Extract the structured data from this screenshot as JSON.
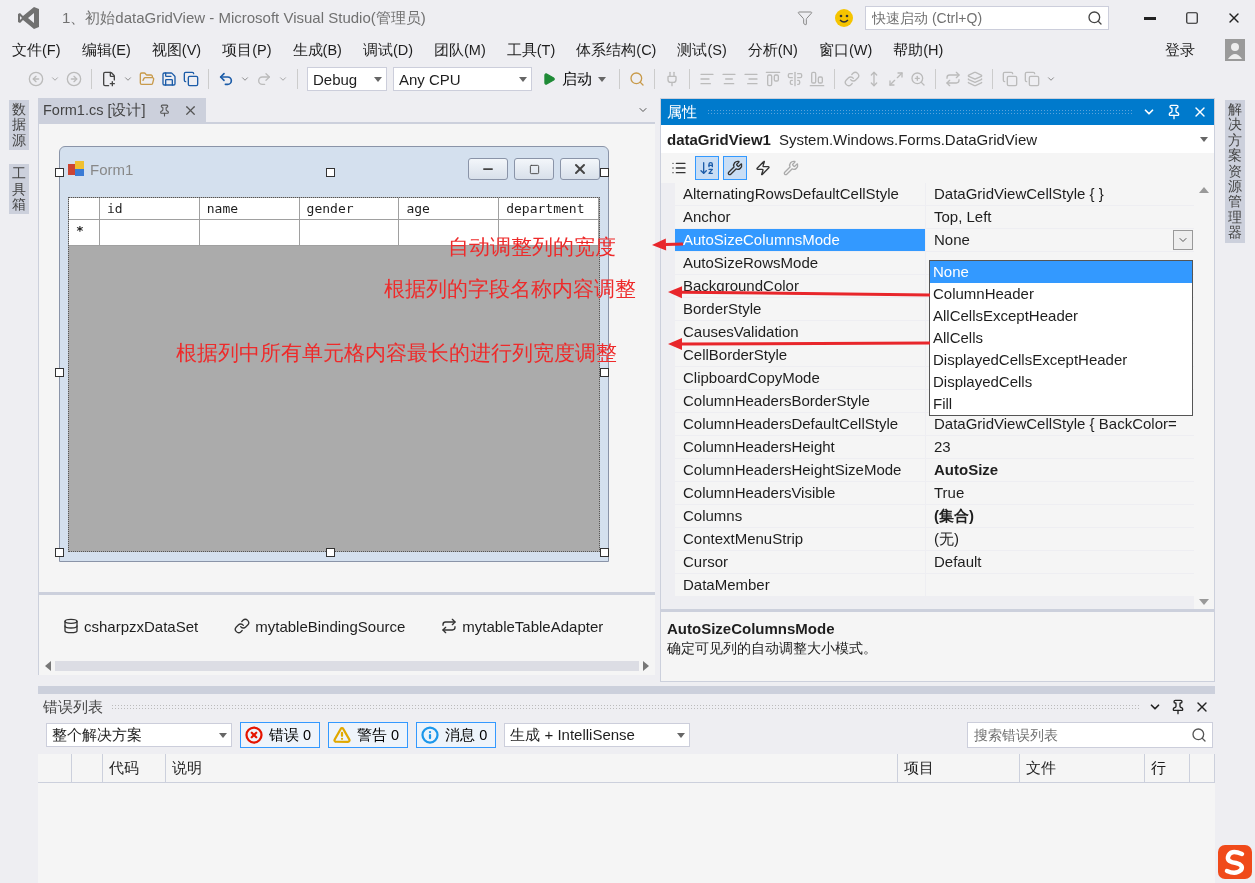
{
  "window": {
    "title": "1、初始dataGridView - Microsoft Visual Studio(管理员)",
    "quick_launch": {
      "placeholder": "快速启动 (Ctrl+Q)"
    },
    "sign_in": "登录"
  },
  "menu": [
    "文件(F)",
    "编辑(E)",
    "视图(V)",
    "项目(P)",
    "生成(B)",
    "调试(D)",
    "团队(M)",
    "工具(T)",
    "体系结构(C)",
    "测试(S)",
    "分析(N)",
    "窗口(W)",
    "帮助(H)"
  ],
  "toolbar": {
    "configuration": "Debug",
    "platform": "Any CPU",
    "start": "启动"
  },
  "left_tabs": [
    "数据源",
    "工具箱"
  ],
  "right_tabs": [
    "解决方案资源管理器"
  ],
  "designer": {
    "tab": "Form1.cs [设计]",
    "form_title": "Form1",
    "grid": {
      "columns": [
        "id",
        "name",
        "gender",
        "age",
        "department"
      ],
      "new_row_marker": "*"
    },
    "components": [
      "csharpzxDataSet",
      "mytableBindingSource",
      "mytableTableAdapter"
    ]
  },
  "properties": {
    "title": "属性",
    "object_name": "dataGridView1",
    "object_type": "System.Windows.Forms.DataGridView",
    "rows": [
      {
        "name": "AlternatingRowsDefaultCellStyle",
        "value": "DataGridViewCellStyle { }",
        "modified": false,
        "selected": false
      },
      {
        "name": "Anchor",
        "value": "Top, Left",
        "modified": false,
        "selected": false
      },
      {
        "name": "AutoSizeColumnsMode",
        "value": "None",
        "modified": false,
        "selected": true
      },
      {
        "name": "AutoSizeRowsMode",
        "modified": false,
        "selected": false
      },
      {
        "name": "BackgroundColor",
        "modified": false,
        "selected": false
      },
      {
        "name": "BorderStyle",
        "modified": false,
        "selected": false
      },
      {
        "name": "CausesValidation",
        "modified": false,
        "selected": false
      },
      {
        "name": "CellBorderStyle",
        "modified": false,
        "selected": false
      },
      {
        "name": "ClipboardCopyMode",
        "modified": false,
        "selected": false
      },
      {
        "name": "ColumnHeadersBorderStyle",
        "modified": false,
        "selected": false
      },
      {
        "name": "ColumnHeadersDefaultCellStyle",
        "value": "DataGridViewCellStyle { BackColor=",
        "modified": false,
        "selected": false
      },
      {
        "name": "ColumnHeadersHeight",
        "value": "23",
        "modified": false,
        "selected": false
      },
      {
        "name": "ColumnHeadersHeightSizeMode",
        "value": "AutoSize",
        "modified": true,
        "selected": false
      },
      {
        "name": "ColumnHeadersVisible",
        "value": "True",
        "modified": false,
        "selected": false
      },
      {
        "name": "Columns",
        "value": "(集合)",
        "modified": true,
        "selected": false
      },
      {
        "name": "ContextMenuStrip",
        "value": "(无)",
        "modified": false,
        "selected": false
      },
      {
        "name": "Cursor",
        "value": "Default",
        "modified": false,
        "selected": false
      },
      {
        "name": "DataMember",
        "modified": false,
        "selected": false
      }
    ],
    "dropdown": [
      {
        "label": "None",
        "selected": true
      },
      {
        "label": "ColumnHeader",
        "selected": false
      },
      {
        "label": "AllCellsExceptHeader",
        "selected": false
      },
      {
        "label": "AllCells",
        "selected": false
      },
      {
        "label": "DisplayedCellsExceptHeader",
        "selected": false
      },
      {
        "label": "DisplayedCells",
        "selected": false
      },
      {
        "label": "Fill",
        "selected": false
      }
    ],
    "description": {
      "title": "AutoSizeColumnsMode",
      "text": "确定可见列的自动调整大小模式。"
    }
  },
  "annotations": [
    "自动调整列的宽度",
    "根据列的字段名称内容调整",
    "根据列中所有单元格内容最长的进行列宽度调整"
  ],
  "error_list": {
    "title": "错误列表",
    "scope": "整个解决方案",
    "filters": [
      {
        "kind": "error",
        "label": "错误 0",
        "selected": true
      },
      {
        "kind": "warning",
        "label": "警告 0",
        "selected": true
      },
      {
        "kind": "info",
        "label": "消息 0",
        "selected": true
      }
    ],
    "source": "生成 + IntelliSense",
    "search": {
      "placeholder": "搜索错误列表"
    },
    "columns": [
      "代码",
      "说明",
      "项目",
      "文件",
      "行"
    ]
  }
}
